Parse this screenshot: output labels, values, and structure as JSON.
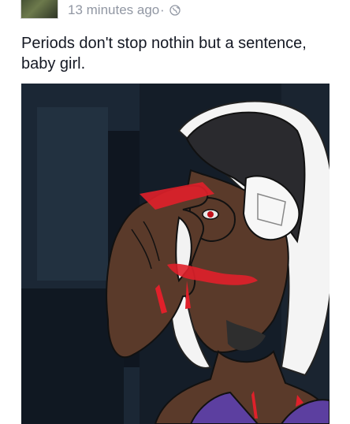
{
  "post": {
    "timestamp": "13 minutes ago",
    "separator": "·",
    "privacy_icon": "globe-icon",
    "text": "Periods don't stop nothin but a sentence, baby girl."
  },
  "photo": {
    "description_icon": "anime-drawing-over-photo"
  },
  "colors": {
    "meta_text": "#9197a3",
    "body_text": "#141823",
    "blood": "#e0202a",
    "skin": "#5a3a2a"
  }
}
